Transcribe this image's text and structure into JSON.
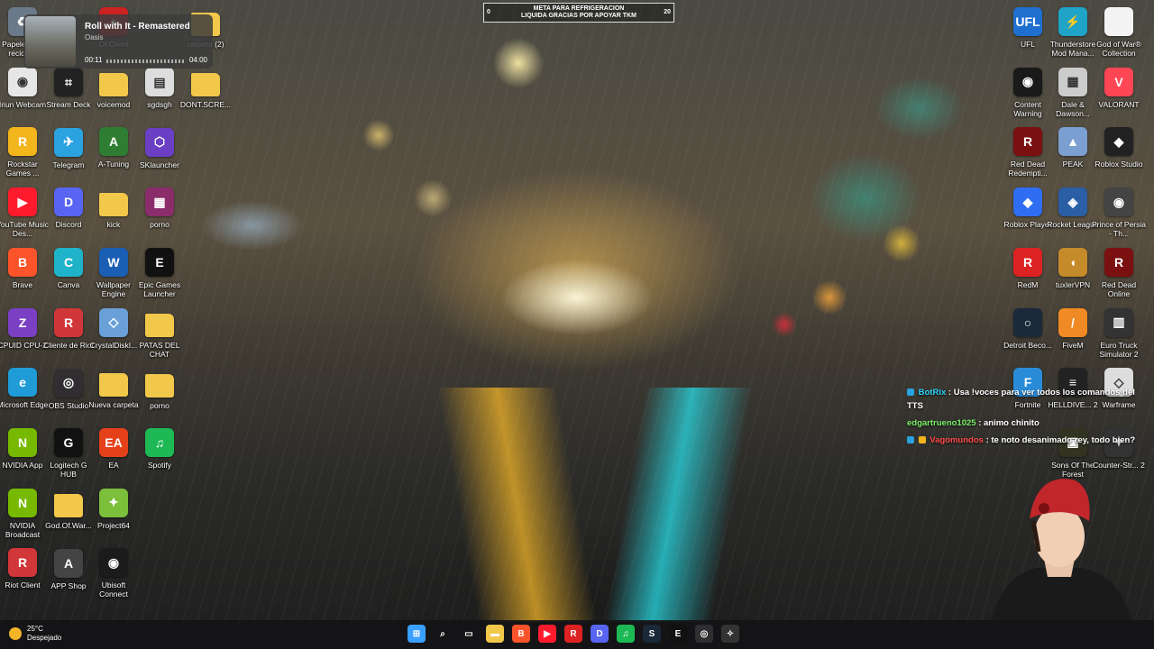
{
  "media_player": {
    "title": "Roll with It - Remastered",
    "artist": "Oasis",
    "elapsed": "00:11",
    "duration": "04:00"
  },
  "goal": {
    "start": "0",
    "end": "20",
    "line1": "META PARA REFRIGERACION",
    "line2": "LIQUIDA GRACIAS POR APOYAR TKM"
  },
  "desktop_left": [
    {
      "label": "Papelera de reciclaje",
      "icon": "recycle-bin-icon",
      "color": "#6b7a8a",
      "glyph": "♻"
    },
    {
      "label": "Iriun Webcam",
      "icon": "webcam-icon",
      "color": "#e6e6e6",
      "glyph": "◉"
    },
    {
      "label": "Rockstar Games ...",
      "icon": "rockstar-icon",
      "color": "#f2b51c",
      "glyph": "R"
    },
    {
      "label": "YouTube Music Des...",
      "icon": "youtube-music-icon",
      "color": "#ff1b2d",
      "glyph": "▶"
    },
    {
      "label": "Brave",
      "icon": "brave-icon",
      "color": "#fb542b",
      "glyph": "B"
    },
    {
      "label": "CPUID CPU-Z",
      "icon": "cpuz-icon",
      "color": "#7b3fc4",
      "glyph": "Z"
    },
    {
      "label": "Microsoft Edge",
      "icon": "edge-icon",
      "color": "#1f9bd7",
      "glyph": "e"
    },
    {
      "label": "NVIDIA App",
      "icon": "nvidia-icon",
      "color": "#76b900",
      "glyph": "N"
    },
    {
      "label": "NVIDIA Broadcast",
      "icon": "nvidia-broadcast-icon",
      "color": "#76b900",
      "glyph": "N"
    },
    {
      "label": "Riot Client",
      "icon": "riot-icon",
      "color": "#d13639",
      "glyph": "R"
    }
  ],
  "desktop_col2": [
    {
      "label": "Stream Deck",
      "icon": "stream-deck-icon",
      "color": "#222",
      "glyph": "⌗"
    },
    {
      "label": "Telegram",
      "icon": "telegram-icon",
      "color": "#2aa3e0",
      "glyph": "✈"
    },
    {
      "label": "Discord",
      "icon": "discord-icon",
      "color": "#5865f2",
      "glyph": "D"
    },
    {
      "label": "Canva",
      "icon": "canva-icon",
      "color": "#1fb3c9",
      "glyph": "C"
    },
    {
      "label": "Cliente de Riot",
      "icon": "riot-client-icon",
      "color": "#d13639",
      "glyph": "R"
    },
    {
      "label": "OBS Studio",
      "icon": "obs-icon",
      "color": "#302e31",
      "glyph": "◎"
    },
    {
      "label": "Logitech G HUB",
      "icon": "logitech-icon",
      "color": "#111",
      "glyph": "G"
    },
    {
      "label": "God.Of.War...",
      "icon": "folder-icon",
      "color": "#f2c84b",
      "glyph": ""
    },
    {
      "label": "APP Shop",
      "icon": "app-shop-icon",
      "color": "#444",
      "glyph": "A"
    }
  ],
  "desktop_col3": [
    {
      "label": "Of Client",
      "icon": "client-icon",
      "color": "#c22",
      "glyph": "+"
    },
    {
      "label": "voicemod",
      "icon": "folder-icon",
      "color": "#f2c84b",
      "glyph": ""
    },
    {
      "label": "A-Tuning",
      "icon": "a-tuning-icon",
      "color": "#2e7d32",
      "glyph": "A"
    },
    {
      "label": "kick",
      "icon": "folder-icon",
      "color": "#f2c84b",
      "glyph": ""
    },
    {
      "label": "Wallpaper Engine",
      "icon": "wallpaper-engine-icon",
      "color": "#1a5fb4",
      "glyph": "W"
    },
    {
      "label": "CrystalDiskI...",
      "icon": "crystaldisk-icon",
      "color": "#6aa0d8",
      "glyph": "◇"
    },
    {
      "label": "Nueva carpeta",
      "icon": "folder-icon",
      "color": "#f2c84b",
      "glyph": ""
    },
    {
      "label": "EA",
      "icon": "ea-icon",
      "color": "#e4411b",
      "glyph": "EA"
    },
    {
      "label": "Project64",
      "icon": "project64-icon",
      "color": "#7bbf3a",
      "glyph": "✦"
    },
    {
      "label": "Ubisoft Connect",
      "icon": "ubisoft-icon",
      "color": "#1b1b1b",
      "glyph": "◉"
    }
  ],
  "desktop_col4": [
    {
      "label": "sgdsgh",
      "icon": "image-file-icon",
      "color": "#ddd",
      "glyph": "▤"
    },
    {
      "label": "SKlauncher",
      "icon": "sklauncher-icon",
      "color": "#6a3fc4",
      "glyph": "⬡"
    },
    {
      "label": "porno",
      "icon": "winrar-icon",
      "color": "#8b2d6b",
      "glyph": "▦"
    },
    {
      "label": "Epic Games Launcher",
      "icon": "epic-games-icon",
      "color": "#111",
      "glyph": "E"
    },
    {
      "label": "PATAS DEL CHAT",
      "icon": "folder-icon",
      "color": "#f2c84b",
      "glyph": ""
    },
    {
      "label": "porno",
      "icon": "folder-icon",
      "color": "#f2c84b",
      "glyph": ""
    },
    {
      "label": "Spotify",
      "icon": "spotify-icon",
      "color": "#1db954",
      "glyph": "♫"
    }
  ],
  "desktop_col5": [
    {
      "label": "carpeta (2)",
      "icon": "folder-icon",
      "color": "#f2c84b",
      "glyph": ""
    },
    {
      "label": "DONT.SCRE...",
      "icon": "folder-icon",
      "color": "#f2c84b",
      "glyph": ""
    }
  ],
  "desktop_right1": [
    {
      "label": "UFL",
      "icon": "ufl-icon",
      "color": "#1f6fd1",
      "glyph": "UFL"
    },
    {
      "label": "Content Warning",
      "icon": "content-warning-icon",
      "color": "#1a1a1a",
      "glyph": "◉"
    },
    {
      "label": "Red Dead Redempti...",
      "icon": "red-dead-icon",
      "color": "#7a1010",
      "glyph": "R"
    },
    {
      "label": "Roblox Player",
      "icon": "roblox-icon",
      "color": "#2f6ef2",
      "glyph": "◆"
    },
    {
      "label": "RedM",
      "icon": "redm-icon",
      "color": "#d22",
      "glyph": "R"
    },
    {
      "label": "Detroit Beco...",
      "icon": "detroit-icon",
      "color": "#1a2a3a",
      "glyph": "○"
    },
    {
      "label": "Fortnite",
      "icon": "fortnite-icon",
      "color": "#2a8cd8",
      "glyph": "F"
    }
  ],
  "desktop_right2": [
    {
      "label": "Thunderstore Mod Mana...",
      "icon": "thunderstore-icon",
      "color": "#1fa3c7",
      "glyph": "⚡"
    },
    {
      "label": "Dale & Dawson...",
      "icon": "dale-dawson-icon",
      "color": "#ccc",
      "glyph": "▦"
    },
    {
      "label": "PEAK",
      "icon": "peak-icon",
      "color": "#7a9fd0",
      "glyph": "▲"
    },
    {
      "label": "Rocket League",
      "icon": "rocket-league-icon",
      "color": "#2a5fa5",
      "glyph": "◈"
    },
    {
      "label": "tuxlerVPN",
      "icon": "tuxler-icon",
      "color": "#c58a2a",
      "glyph": "◖"
    },
    {
      "label": "FiveM",
      "icon": "fivem-icon",
      "color": "#f08a24",
      "glyph": "/"
    },
    {
      "label": "HELLDIVE... 2",
      "icon": "helldivers-icon",
      "color": "#222",
      "glyph": "≡"
    },
    {
      "label": "Sons Of The Forest",
      "icon": "sons-forest-icon",
      "color": "#332",
      "glyph": "▣"
    }
  ],
  "desktop_right3": [
    {
      "label": "God of War® Collection",
      "icon": "document-icon",
      "color": "#f4f4f4",
      "glyph": ""
    },
    {
      "label": "VALORANT",
      "icon": "valorant-icon",
      "color": "#ff4655",
      "glyph": "V"
    },
    {
      "label": "Roblox Studio",
      "icon": "roblox-studio-icon",
      "color": "#222",
      "glyph": "◆"
    },
    {
      "label": "Prince of Persia - Th...",
      "icon": "prince-persia-icon",
      "color": "#444",
      "glyph": "◉"
    },
    {
      "label": "Red Dead Online",
      "icon": "red-dead-online-icon",
      "color": "#7a1010",
      "glyph": "R"
    },
    {
      "label": "Euro Truck Simulator 2",
      "icon": "euro-truck-icon",
      "color": "#333",
      "glyph": "▥"
    },
    {
      "label": "Warframe",
      "icon": "warframe-icon",
      "color": "#ddd",
      "glyph": "◇"
    },
    {
      "label": "Counter-Str... 2",
      "icon": "counter-strike-icon",
      "color": "#333",
      "glyph": "✦"
    }
  ],
  "chat": [
    {
      "user": "BotRix",
      "user_color": "#2ed2ff",
      "text": ": Usa !voces para ver todos los comandos del TTS"
    },
    {
      "user": "edgartrueno1025",
      "user_color": "#7cf06a",
      "text": ": animo chinito"
    },
    {
      "user": "Vagomundos",
      "user_color": "#ff4b4b",
      "text": ": te noto desanimado rey, todo bien?"
    }
  ],
  "weather": {
    "temp": "25°C",
    "condition": "Despejado"
  },
  "taskbar": [
    {
      "name": "start-icon",
      "color": "#3aa0ff",
      "glyph": "⊞"
    },
    {
      "name": "search-icon",
      "color": "transparent",
      "glyph": "⌕"
    },
    {
      "name": "task-view-icon",
      "color": "transparent",
      "glyph": "▭"
    },
    {
      "name": "file-explorer-icon",
      "color": "#f2c84b",
      "glyph": "▬"
    },
    {
      "name": "brave-taskbar-icon",
      "color": "#fb542b",
      "glyph": "B"
    },
    {
      "name": "youtube-music-taskbar-icon",
      "color": "#ff1b2d",
      "glyph": "▶"
    },
    {
      "name": "redm-taskbar-icon",
      "color": "#d22",
      "glyph": "R"
    },
    {
      "name": "discord-taskbar-icon",
      "color": "#5865f2",
      "glyph": "D"
    },
    {
      "name": "spotify-taskbar-icon",
      "color": "#1db954",
      "glyph": "♫"
    },
    {
      "name": "steam-taskbar-icon",
      "color": "#1b2838",
      "glyph": "S"
    },
    {
      "name": "epic-taskbar-icon",
      "color": "#111",
      "glyph": "E"
    },
    {
      "name": "obs-taskbar-icon",
      "color": "#302e31",
      "glyph": "◎"
    },
    {
      "name": "streamer-bot-taskbar-icon",
      "color": "#333",
      "glyph": "✧"
    }
  ]
}
